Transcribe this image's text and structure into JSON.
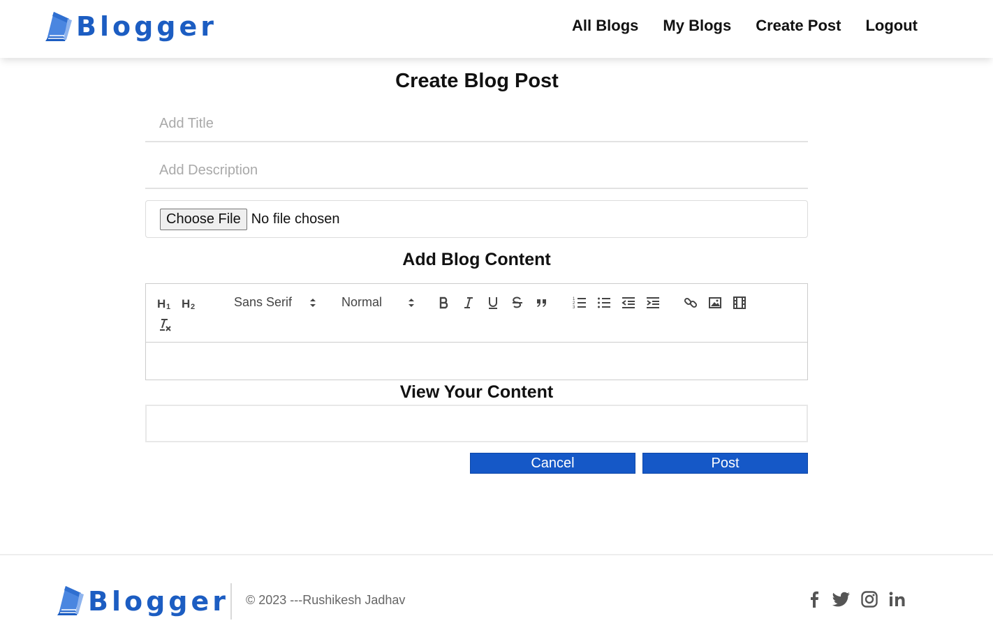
{
  "brand": {
    "name": "Blogger",
    "color": "#1c5dc2"
  },
  "nav": {
    "items": [
      {
        "label": "All Blogs"
      },
      {
        "label": "My Blogs"
      },
      {
        "label": "Create Post"
      },
      {
        "label": "Logout"
      }
    ]
  },
  "form": {
    "page_title": "Create Blog Post",
    "title_placeholder": "Add Title",
    "description_placeholder": "Add Description",
    "file_button_label": "Choose File",
    "file_status": "No file chosen",
    "content_heading": "Add Blog Content",
    "view_heading": "View Your Content"
  },
  "toolbar": {
    "h1_icon": "header-1-icon",
    "h2_icon": "header-2-icon",
    "font_picker_value": "Sans Serif",
    "size_picker_value": "Normal",
    "icons": [
      "bold-icon",
      "italic-icon",
      "underline-icon",
      "strikethrough-icon",
      "blockquote-icon",
      "ordered-list-icon",
      "bullet-list-icon",
      "outdent-icon",
      "indent-icon",
      "link-icon",
      "image-icon",
      "video-icon",
      "clear-format-icon"
    ]
  },
  "actions": {
    "cancel_label": "Cancel",
    "post_label": "Post",
    "button_color": "#1558c7"
  },
  "footer": {
    "copyright": "© 2023 ---Rushikesh Jadhav",
    "social_icons": [
      "facebook-icon",
      "twitter-icon",
      "instagram-icon",
      "linkedin-icon"
    ]
  }
}
